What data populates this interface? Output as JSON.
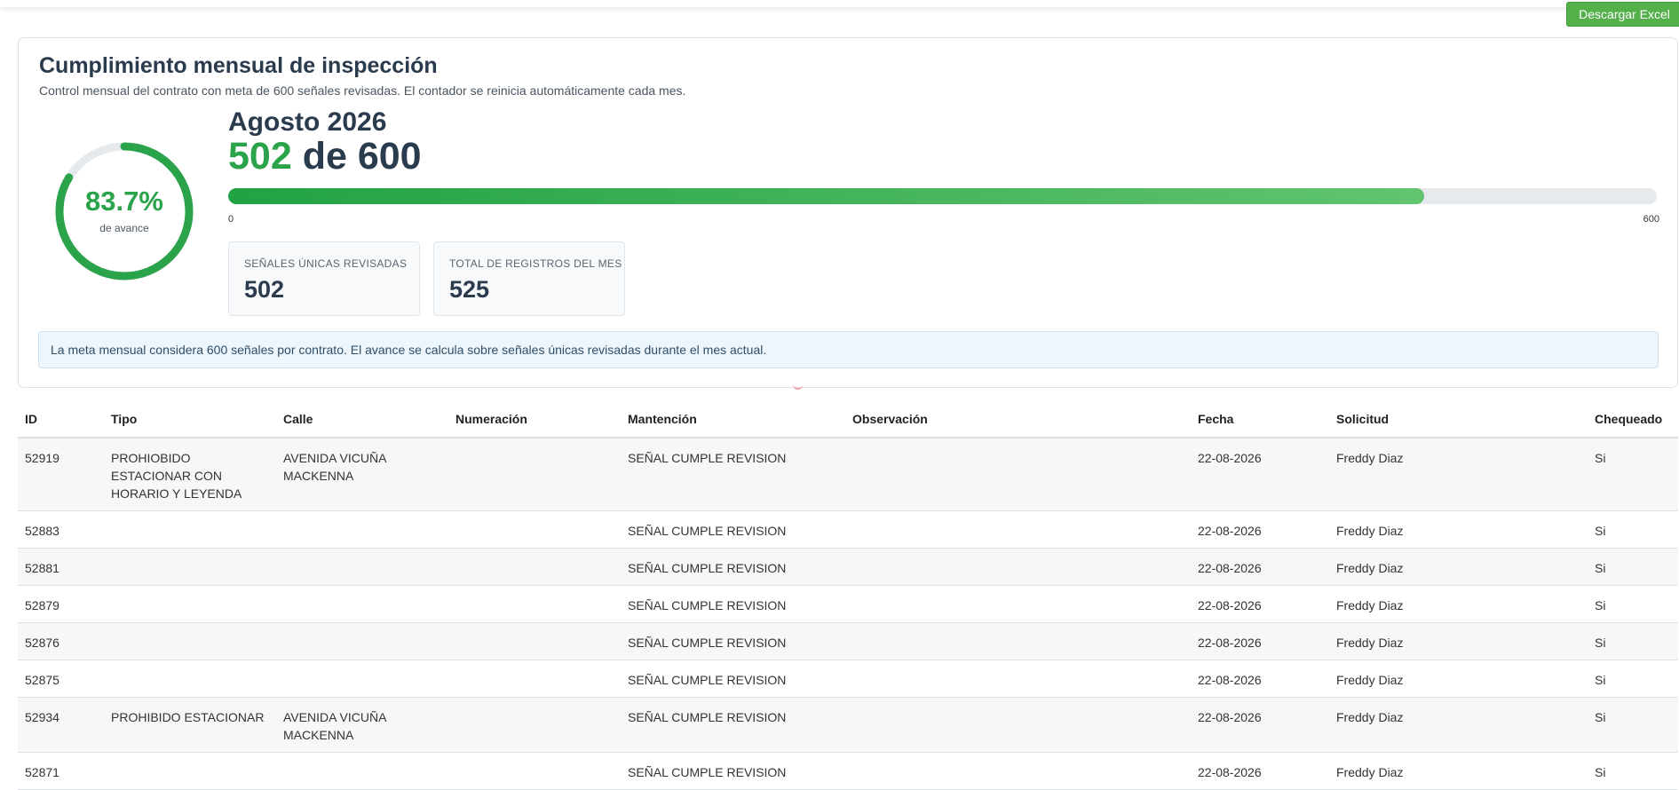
{
  "toolbar": {
    "excel_label": "Descargar Excel"
  },
  "summary": {
    "title": "Cumplimiento mensual de inspección",
    "subtitle": "Control mensual del contrato con meta de 600 señales revisadas. El contador se reinicia automáticamente cada mes.",
    "percent_label": "83.7%",
    "percent_value": 83.7,
    "percent_caption": "de avance",
    "month": "Agosto 2026",
    "done": "502",
    "of_text": "de",
    "goal": "600",
    "bar_min": "0",
    "bar_max": "600",
    "stats": [
      {
        "label": "SEÑALES ÚNICAS REVISADAS",
        "value": "502"
      },
      {
        "label": "TOTAL DE REGISTROS DEL MES",
        "value": "525"
      }
    ],
    "note": "La meta mensual considera 600 señales por contrato. El avance se calcula sobre señales únicas revisadas durante el mes actual."
  },
  "colors": {
    "accent": "#2aa34a",
    "excel_button": "#53b04a",
    "ring_track": "#e6eaed"
  },
  "table": {
    "columns": [
      "ID",
      "Tipo",
      "Calle",
      "Numeración",
      "Mantención",
      "Observación",
      "Fecha",
      "Solicitud",
      "Chequeado"
    ],
    "rows": [
      [
        "52919",
        "PROHIOBIDO ESTACIONAR CON HORARIO Y LEYENDA",
        "AVENIDA VICUÑA MACKENNA",
        "",
        "SEÑAL CUMPLE REVISION",
        "",
        "22-08-2026",
        "Freddy Diaz",
        "Si"
      ],
      [
        "52883",
        "",
        "",
        "",
        "SEÑAL CUMPLE REVISION",
        "",
        "22-08-2026",
        "Freddy Diaz",
        "Si"
      ],
      [
        "52881",
        "",
        "",
        "",
        "SEÑAL CUMPLE REVISION",
        "",
        "22-08-2026",
        "Freddy Diaz",
        "Si"
      ],
      [
        "52879",
        "",
        "",
        "",
        "SEÑAL CUMPLE REVISION",
        "",
        "22-08-2026",
        "Freddy Diaz",
        "Si"
      ],
      [
        "52876",
        "",
        "",
        "",
        "SEÑAL CUMPLE REVISION",
        "",
        "22-08-2026",
        "Freddy Diaz",
        "Si"
      ],
      [
        "52875",
        "",
        "",
        "",
        "SEÑAL CUMPLE REVISION",
        "",
        "22-08-2026",
        "Freddy Diaz",
        "Si"
      ],
      [
        "52934",
        "PROHIBIDO ESTACIONAR",
        "AVENIDA VICUÑA MACKENNA",
        "",
        "SEÑAL CUMPLE REVISION",
        "",
        "22-08-2026",
        "Freddy Diaz",
        "Si"
      ],
      [
        "52871",
        "",
        "",
        "",
        "SEÑAL CUMPLE REVISION",
        "",
        "22-08-2026",
        "Freddy Diaz",
        "Si"
      ]
    ]
  }
}
